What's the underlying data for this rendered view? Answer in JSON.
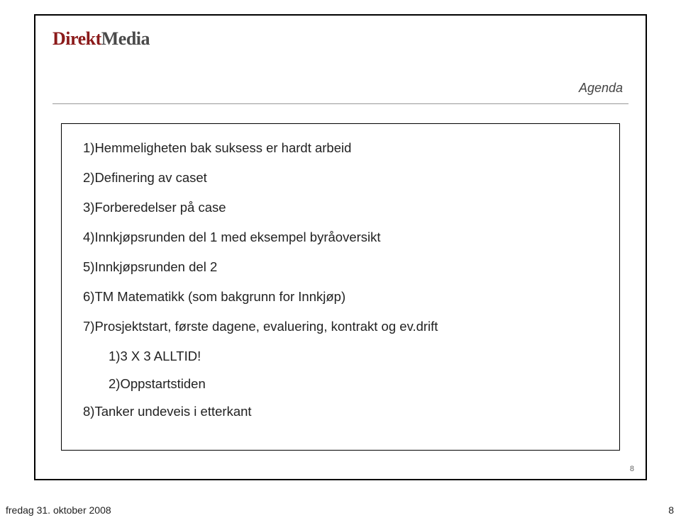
{
  "logo": {
    "part1": "Direkt",
    "part2": "Media"
  },
  "agenda_title": "Agenda",
  "items": [
    "1)Hemmeligheten bak suksess er hardt arbeid",
    "2)Definering av caset",
    "3)Forberedelser på case",
    "4)Innkjøpsrunden del 1 med eksempel byråoversikt",
    "5)Innkjøpsrunden del 2",
    "6)TM Matematikk (som bakgrunn for Innkjøp)",
    "7)Prosjektstart, første dagene, evaluering, kontrakt og ev.drift"
  ],
  "subitems": [
    "1)3 X 3 ALLTID!",
    "2)Oppstartstiden"
  ],
  "last_item": "8)Tanker undeveis i etterkant",
  "page_number": "8",
  "footer_date": "fredag 31. oktober 2008",
  "footer_page": "8"
}
